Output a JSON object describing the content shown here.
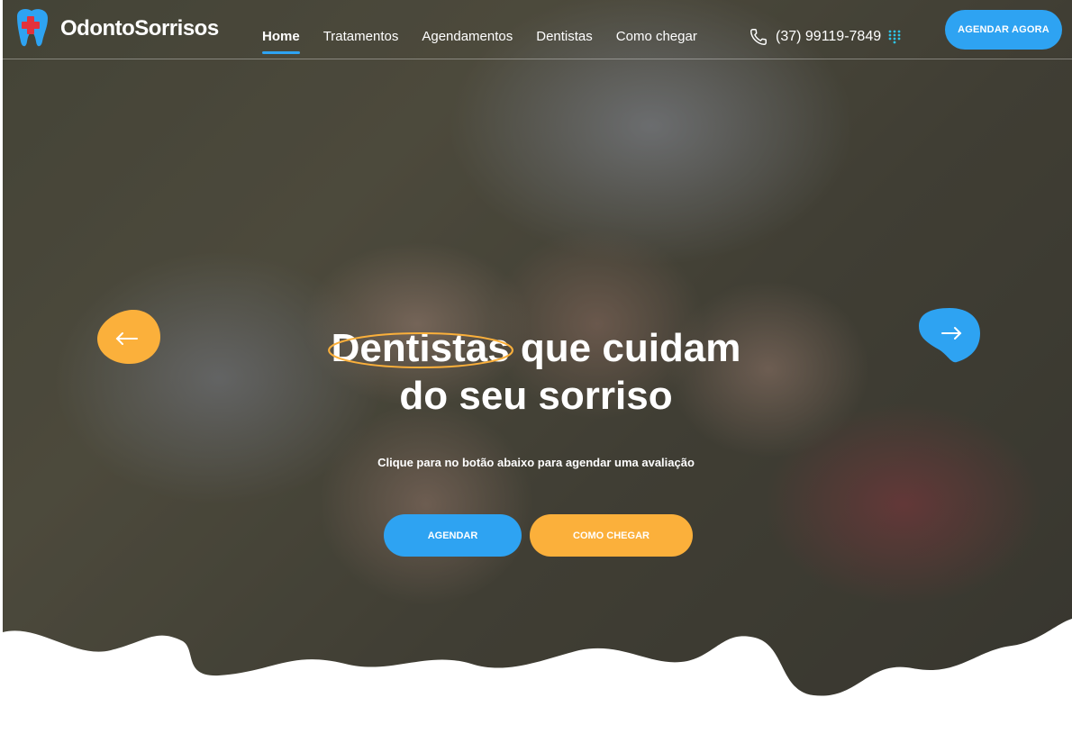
{
  "brand": {
    "name": "OdontoSorrisos",
    "accent": "#2ea3f2",
    "secondary": "#fbb03b"
  },
  "nav": {
    "items": [
      {
        "label": "Home",
        "active": true
      },
      {
        "label": "Tratamentos"
      },
      {
        "label": "Agendamentos"
      },
      {
        "label": "Dentistas"
      },
      {
        "label": "Como chegar"
      }
    ]
  },
  "contact": {
    "phone": "(37) 99119-7849",
    "phone_icon": "phone-icon",
    "menu_icon": "dots-grid-icon"
  },
  "header": {
    "cta_label": "AGENDAR AGORA"
  },
  "hero": {
    "headline_highlight": "Dentistas",
    "headline_rest_line1": "que cuidam",
    "headline_line2": "do seu sorriso",
    "subtitle": "Clique para no botão abaixo para agendar uma avaliação",
    "primary_button": "AGENDAR",
    "secondary_button": "COMO CHEGAR"
  },
  "carousel": {
    "prev_icon": "arrow-left-icon",
    "next_icon": "arrow-right-icon"
  }
}
